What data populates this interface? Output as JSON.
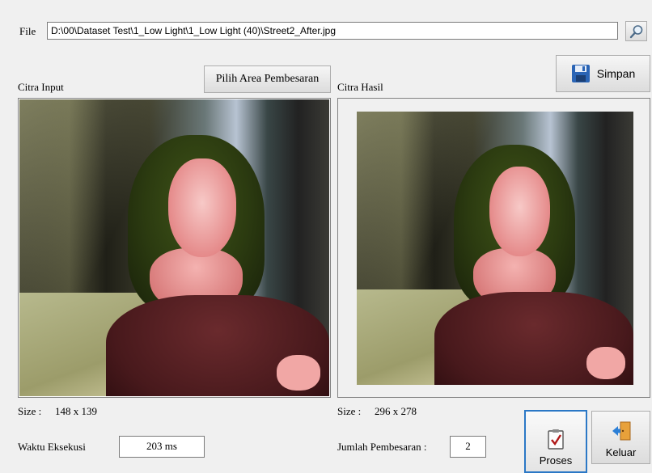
{
  "file": {
    "label": "File",
    "path": "D:\\00\\Dataset Test\\1_Low Light\\1_Low Light (40)\\Street2_After.jpg",
    "browse_icon": "magnifier-icon"
  },
  "toolbar": {
    "save_label": "Simpan",
    "save_icon": "floppy-disk-icon",
    "zoom_area_label": "Pilih Area Pembesaran"
  },
  "input_panel": {
    "title": "Citra Input",
    "size_label": "Size :",
    "size_value": "148 x 139",
    "time_label": "Waktu Eksekusi",
    "time_value": "203 ms"
  },
  "result_panel": {
    "title": "Citra Hasil",
    "size_label": "Size :",
    "size_value": "296 x 278",
    "zoom_label": "Jumlah Pembesaran :",
    "zoom_value": "2"
  },
  "actions": {
    "process_label": "Proses",
    "process_icon": "clipboard-check-icon",
    "exit_label": "Keluar",
    "exit_icon": "exit-door-icon"
  }
}
